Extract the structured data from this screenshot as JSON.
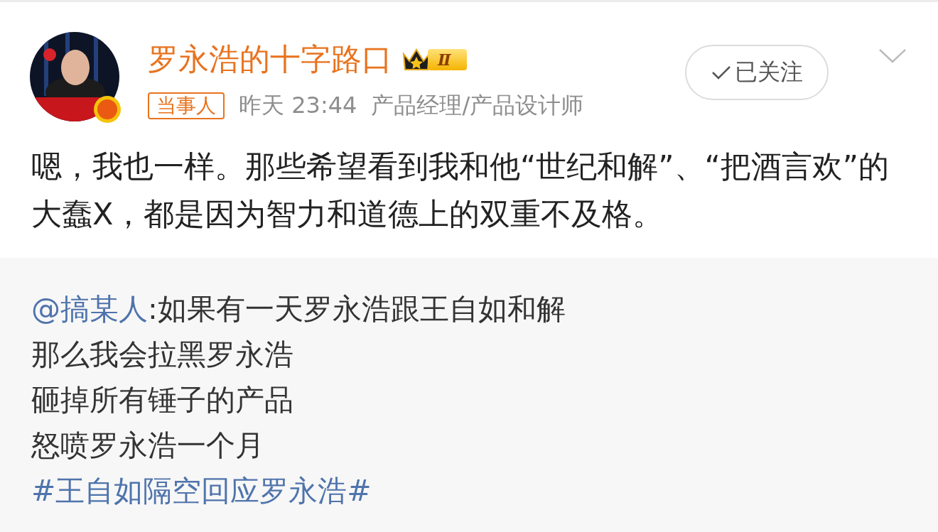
{
  "post": {
    "author": {
      "name": "罗永浩的十字路口",
      "level_badge": "Ⅱ",
      "verified": true
    },
    "tag": "当事人",
    "time": "昨天 23:44",
    "profession": "产品经理/产品设计师",
    "follow": {
      "label": "已关注",
      "followed": true
    },
    "text": "嗯，我也一样。那些希望看到我和他“世纪和解”、“把酒言欢”的大蠢X，都是因为智力和道德上的双重不及格。"
  },
  "repost": {
    "mention": "@搞某人",
    "first_line": ":如果有一天罗永浩跟王自如和解",
    "lines": [
      "那么我会拉黑罗永浩",
      "砸掉所有锤子的产品",
      "怒喷罗永浩一个月"
    ],
    "hashtag": "#王自如隔空回应罗永浩#"
  }
}
